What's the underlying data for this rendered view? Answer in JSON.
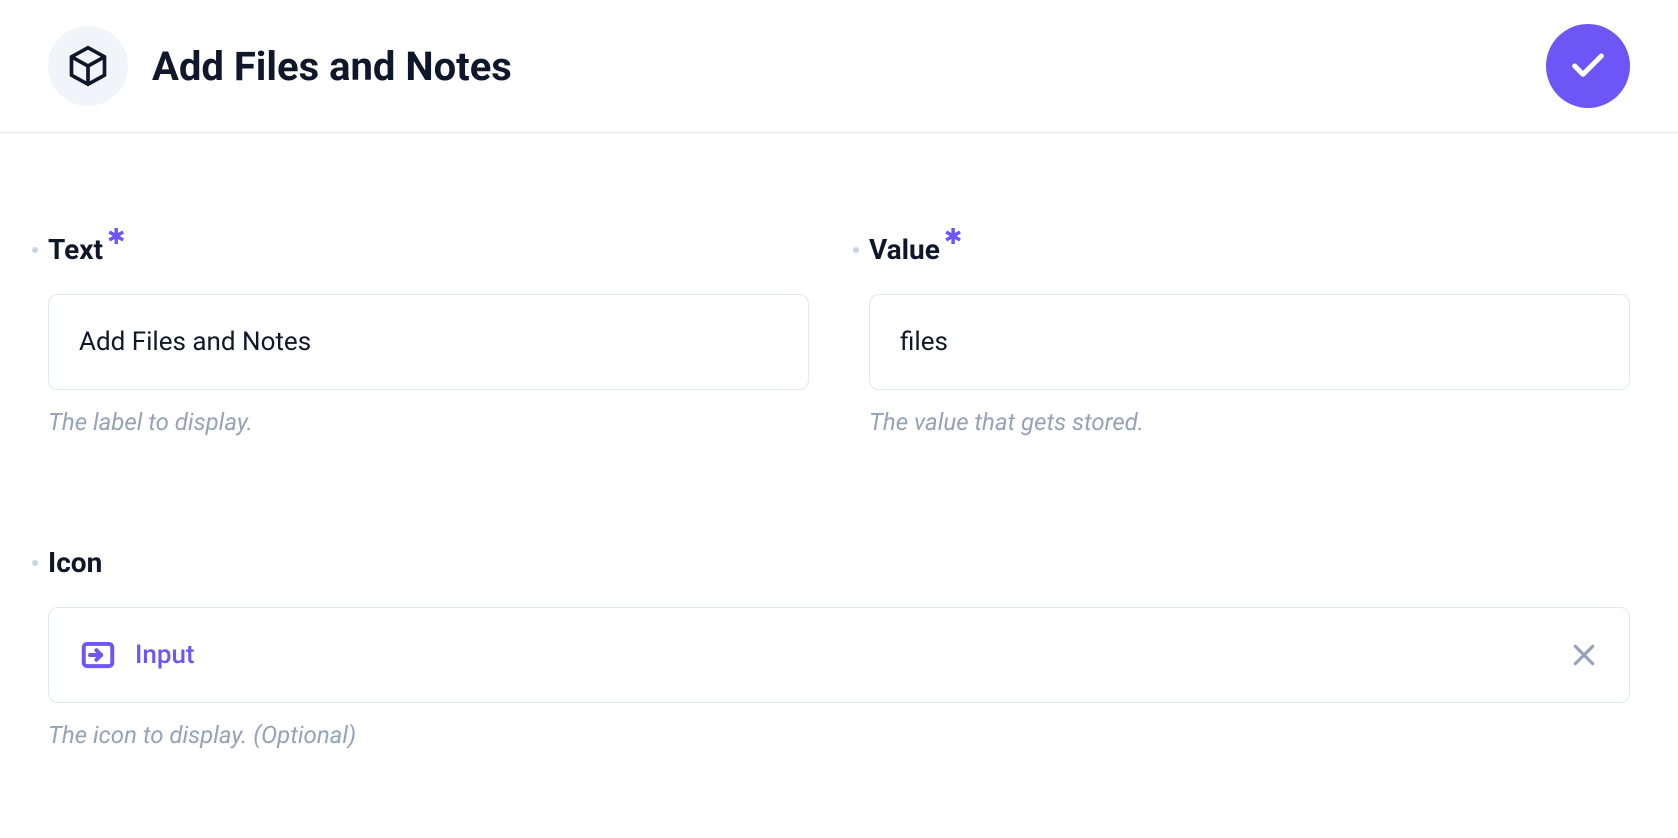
{
  "header": {
    "title": "Add Files and Notes"
  },
  "fields": {
    "text": {
      "label": "Text",
      "required": true,
      "value": "Add Files and Notes",
      "help": "The label to display."
    },
    "value": {
      "label": "Value",
      "required": true,
      "value": "files",
      "help": "The value that gets stored."
    },
    "icon": {
      "label": "Icon",
      "required": false,
      "selected": "Input",
      "help": "The icon to display. (Optional)"
    }
  }
}
